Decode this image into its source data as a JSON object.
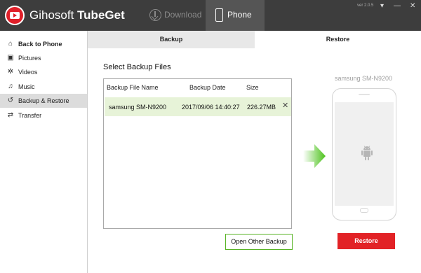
{
  "app": {
    "title_light": "Gihosoft ",
    "title_bold": "TubeGet",
    "version": "ver 2.0.5"
  },
  "topnav": {
    "download_label": "Download",
    "phone_label": "Phone"
  },
  "window_controls": {
    "menu": "▾",
    "minimize": "—",
    "close": "✕"
  },
  "sidebar": {
    "items": [
      {
        "label": "Back to Phone",
        "icon": "home-icon",
        "glyph": "⌂"
      },
      {
        "label": "Pictures",
        "icon": "picture-icon",
        "glyph": "▣"
      },
      {
        "label": "Videos",
        "icon": "film-reel-icon",
        "glyph": "✲"
      },
      {
        "label": "Music",
        "icon": "music-note-icon",
        "glyph": "♫"
      },
      {
        "label": "Backup & Restore",
        "icon": "history-icon",
        "glyph": "↺"
      },
      {
        "label": "Transfer",
        "icon": "transfer-icon",
        "glyph": "⇄"
      }
    ],
    "active_index": 4
  },
  "tabs": {
    "backup": "Backup",
    "restore": "Restore",
    "active": "restore"
  },
  "panel": {
    "title": "Select Backup Files",
    "columns": [
      "Backup File Name",
      "Backup Date",
      "Size"
    ],
    "rows": [
      {
        "name": "samsung SM-N9200",
        "date": "2017/09/06 14:40:27",
        "size": "226.27MB",
        "selected": true
      }
    ],
    "open_other_label": "Open Other Backup"
  },
  "device": {
    "name": "samsung SM-N9200",
    "restore_label": "Restore"
  },
  "colors": {
    "titlebar": "#3d3d3d",
    "accent_green": "#57b324",
    "selected_row": "#e7f3d8",
    "restore_red": "#e22226"
  }
}
